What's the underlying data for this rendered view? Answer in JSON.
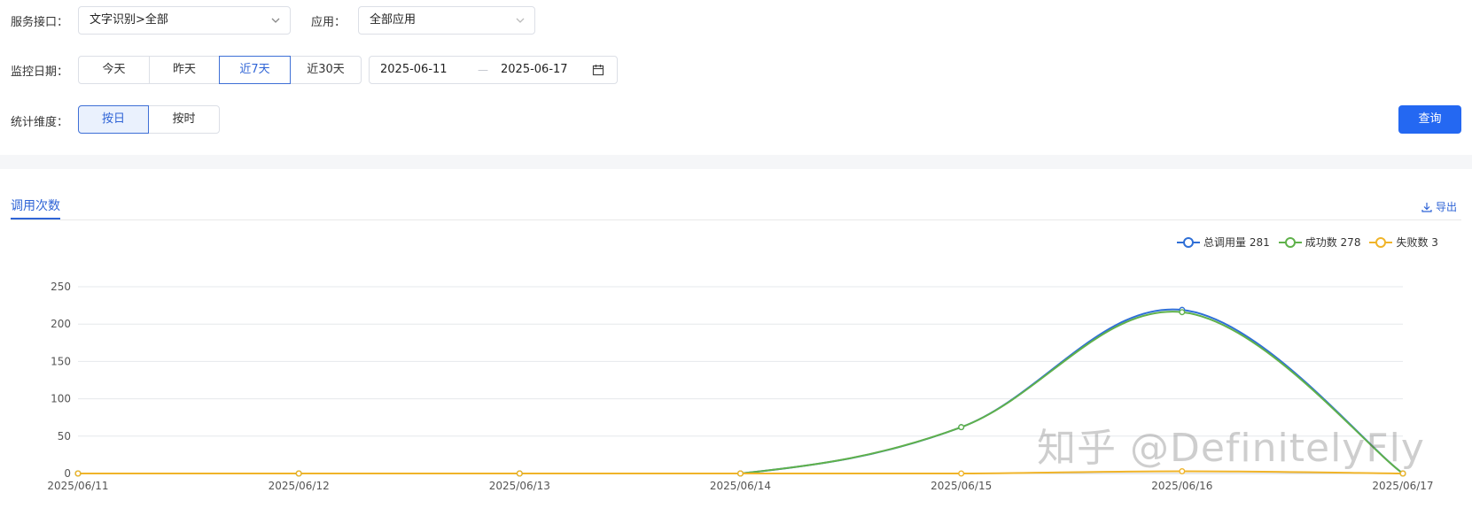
{
  "filters": {
    "service": {
      "label": "服务接口：",
      "value": "文字识别>全部"
    },
    "app": {
      "label": "应用：",
      "value": "全部应用"
    },
    "date": {
      "label": "监控日期：",
      "options": [
        "今天",
        "昨天",
        "近7天",
        "近30天"
      ],
      "active": "近7天",
      "start": "2025-06-11",
      "end": "2025-06-17",
      "separator": "—"
    },
    "dimension": {
      "label": "统计维度：",
      "options": [
        "按日",
        "按时"
      ],
      "active": "按日"
    },
    "query_label": "查询"
  },
  "tabs": {
    "active": "调用次数"
  },
  "export_label": "导出",
  "legend": [
    {
      "name": "总调用量 281",
      "color": "#2f6fd6"
    },
    {
      "name": "成功数 278",
      "color": "#5fb14a"
    },
    {
      "name": "失败数 3",
      "color": "#f0b429"
    }
  ],
  "watermark": "知乎 @DefinitelyFly",
  "chart_data": {
    "type": "line",
    "x": [
      "2025/06/11",
      "2025/06/12",
      "2025/06/13",
      "2025/06/14",
      "2025/06/15",
      "2025/06/16",
      "2025/06/17"
    ],
    "series": [
      {
        "name": "总调用量",
        "values": [
          0,
          0,
          0,
          0,
          62,
          219,
          0
        ],
        "color": "#2f6fd6"
      },
      {
        "name": "成功数",
        "values": [
          0,
          0,
          0,
          0,
          62,
          216,
          0
        ],
        "color": "#5fb14a"
      },
      {
        "name": "失败数",
        "values": [
          0,
          0,
          0,
          0,
          0,
          3,
          0
        ],
        "color": "#f0b429"
      }
    ],
    "yticks": [
      0,
      50,
      100,
      150,
      200,
      250
    ],
    "ylim": [
      0,
      250
    ],
    "grid": true,
    "legend_position": "top-right"
  }
}
